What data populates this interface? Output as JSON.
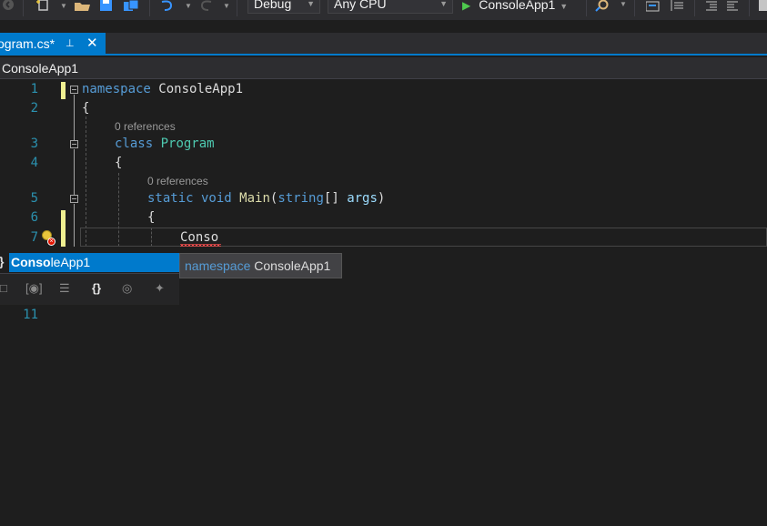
{
  "toolbar": {
    "configuration": "Debug",
    "platform": "Any CPU",
    "run_target": "ConsoleApp1",
    "icons": [
      "circle-back-icon",
      "new-item-icon",
      "open-folder-icon",
      "save-icon",
      "save-all-icon",
      "undo-icon",
      "redo-icon",
      "play-icon",
      "find-icon",
      "overflow-icon",
      "comment-icon",
      "uncomment-icon",
      "bookmark-icon"
    ]
  },
  "tab": {
    "title": "ogram.cs*",
    "pin_icon": "pin-icon",
    "close_icon": "close-icon"
  },
  "navbar": {
    "project": "ConsoleApp1"
  },
  "editor": {
    "line_numbers": [
      "1",
      "2",
      "3",
      "4",
      "5",
      "6",
      "7",
      "11"
    ],
    "lines": {
      "l1_kw": "namespace",
      "l1_name": " ConsoleApp1",
      "l2": "{",
      "lens1": "0 references",
      "l3_kw": "class",
      "l3_name": " Program",
      "l4": "{",
      "lens2": "0 references",
      "l5_kw1": "static",
      "l5_kw2": " void",
      "l5_fn": " Main",
      "l5_open": "(",
      "l5_type": "string",
      "l5_rest": "[] ",
      "l5_param": "args",
      "l5_close": ")",
      "l6": "{",
      "l7": "Conso"
    }
  },
  "completion": {
    "brace_glyph": "}",
    "item_match": "Conso",
    "item_rest": "leApp1",
    "filters": [
      "□",
      "[◉]",
      "☰",
      "{}",
      "◎",
      "✦"
    ],
    "tooltip_kw": "namespace",
    "tooltip_name": " ConsoleApp1"
  },
  "colors": {
    "accent": "#007acc",
    "editor_bg": "#1e1e1e",
    "keyword": "#569cd6",
    "type": "#4ec9b0",
    "method": "#dcdcaa",
    "parameter": "#9cdcfe",
    "line_number": "#2b91af",
    "change_marker": "#efef91",
    "error": "#f14c4c"
  }
}
